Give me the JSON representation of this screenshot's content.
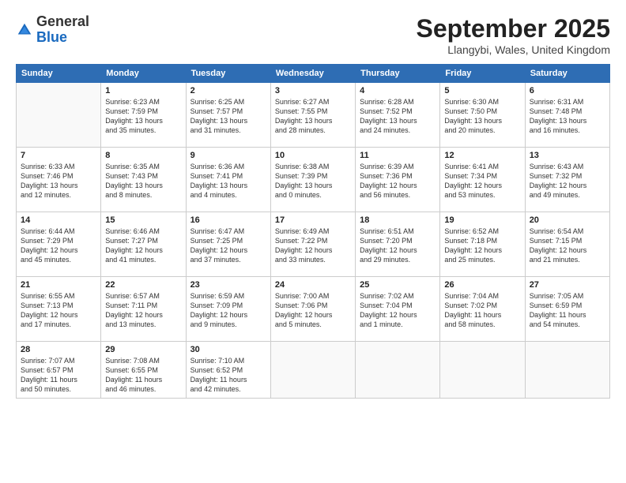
{
  "header": {
    "logo_general": "General",
    "logo_blue": "Blue",
    "month_title": "September 2025",
    "location": "Llangybi, Wales, United Kingdom"
  },
  "days_of_week": [
    "Sunday",
    "Monday",
    "Tuesday",
    "Wednesday",
    "Thursday",
    "Friday",
    "Saturday"
  ],
  "weeks": [
    [
      {
        "day": "",
        "info": ""
      },
      {
        "day": "1",
        "info": "Sunrise: 6:23 AM\nSunset: 7:59 PM\nDaylight: 13 hours\nand 35 minutes."
      },
      {
        "day": "2",
        "info": "Sunrise: 6:25 AM\nSunset: 7:57 PM\nDaylight: 13 hours\nand 31 minutes."
      },
      {
        "day": "3",
        "info": "Sunrise: 6:27 AM\nSunset: 7:55 PM\nDaylight: 13 hours\nand 28 minutes."
      },
      {
        "day": "4",
        "info": "Sunrise: 6:28 AM\nSunset: 7:52 PM\nDaylight: 13 hours\nand 24 minutes."
      },
      {
        "day": "5",
        "info": "Sunrise: 6:30 AM\nSunset: 7:50 PM\nDaylight: 13 hours\nand 20 minutes."
      },
      {
        "day": "6",
        "info": "Sunrise: 6:31 AM\nSunset: 7:48 PM\nDaylight: 13 hours\nand 16 minutes."
      }
    ],
    [
      {
        "day": "7",
        "info": "Sunrise: 6:33 AM\nSunset: 7:46 PM\nDaylight: 13 hours\nand 12 minutes."
      },
      {
        "day": "8",
        "info": "Sunrise: 6:35 AM\nSunset: 7:43 PM\nDaylight: 13 hours\nand 8 minutes."
      },
      {
        "day": "9",
        "info": "Sunrise: 6:36 AM\nSunset: 7:41 PM\nDaylight: 13 hours\nand 4 minutes."
      },
      {
        "day": "10",
        "info": "Sunrise: 6:38 AM\nSunset: 7:39 PM\nDaylight: 13 hours\nand 0 minutes."
      },
      {
        "day": "11",
        "info": "Sunrise: 6:39 AM\nSunset: 7:36 PM\nDaylight: 12 hours\nand 56 minutes."
      },
      {
        "day": "12",
        "info": "Sunrise: 6:41 AM\nSunset: 7:34 PM\nDaylight: 12 hours\nand 53 minutes."
      },
      {
        "day": "13",
        "info": "Sunrise: 6:43 AM\nSunset: 7:32 PM\nDaylight: 12 hours\nand 49 minutes."
      }
    ],
    [
      {
        "day": "14",
        "info": "Sunrise: 6:44 AM\nSunset: 7:29 PM\nDaylight: 12 hours\nand 45 minutes."
      },
      {
        "day": "15",
        "info": "Sunrise: 6:46 AM\nSunset: 7:27 PM\nDaylight: 12 hours\nand 41 minutes."
      },
      {
        "day": "16",
        "info": "Sunrise: 6:47 AM\nSunset: 7:25 PM\nDaylight: 12 hours\nand 37 minutes."
      },
      {
        "day": "17",
        "info": "Sunrise: 6:49 AM\nSunset: 7:22 PM\nDaylight: 12 hours\nand 33 minutes."
      },
      {
        "day": "18",
        "info": "Sunrise: 6:51 AM\nSunset: 7:20 PM\nDaylight: 12 hours\nand 29 minutes."
      },
      {
        "day": "19",
        "info": "Sunrise: 6:52 AM\nSunset: 7:18 PM\nDaylight: 12 hours\nand 25 minutes."
      },
      {
        "day": "20",
        "info": "Sunrise: 6:54 AM\nSunset: 7:15 PM\nDaylight: 12 hours\nand 21 minutes."
      }
    ],
    [
      {
        "day": "21",
        "info": "Sunrise: 6:55 AM\nSunset: 7:13 PM\nDaylight: 12 hours\nand 17 minutes."
      },
      {
        "day": "22",
        "info": "Sunrise: 6:57 AM\nSunset: 7:11 PM\nDaylight: 12 hours\nand 13 minutes."
      },
      {
        "day": "23",
        "info": "Sunrise: 6:59 AM\nSunset: 7:09 PM\nDaylight: 12 hours\nand 9 minutes."
      },
      {
        "day": "24",
        "info": "Sunrise: 7:00 AM\nSunset: 7:06 PM\nDaylight: 12 hours\nand 5 minutes."
      },
      {
        "day": "25",
        "info": "Sunrise: 7:02 AM\nSunset: 7:04 PM\nDaylight: 12 hours\nand 1 minute."
      },
      {
        "day": "26",
        "info": "Sunrise: 7:04 AM\nSunset: 7:02 PM\nDaylight: 11 hours\nand 58 minutes."
      },
      {
        "day": "27",
        "info": "Sunrise: 7:05 AM\nSunset: 6:59 PM\nDaylight: 11 hours\nand 54 minutes."
      }
    ],
    [
      {
        "day": "28",
        "info": "Sunrise: 7:07 AM\nSunset: 6:57 PM\nDaylight: 11 hours\nand 50 minutes."
      },
      {
        "day": "29",
        "info": "Sunrise: 7:08 AM\nSunset: 6:55 PM\nDaylight: 11 hours\nand 46 minutes."
      },
      {
        "day": "30",
        "info": "Sunrise: 7:10 AM\nSunset: 6:52 PM\nDaylight: 11 hours\nand 42 minutes."
      },
      {
        "day": "",
        "info": ""
      },
      {
        "day": "",
        "info": ""
      },
      {
        "day": "",
        "info": ""
      },
      {
        "day": "",
        "info": ""
      }
    ]
  ]
}
